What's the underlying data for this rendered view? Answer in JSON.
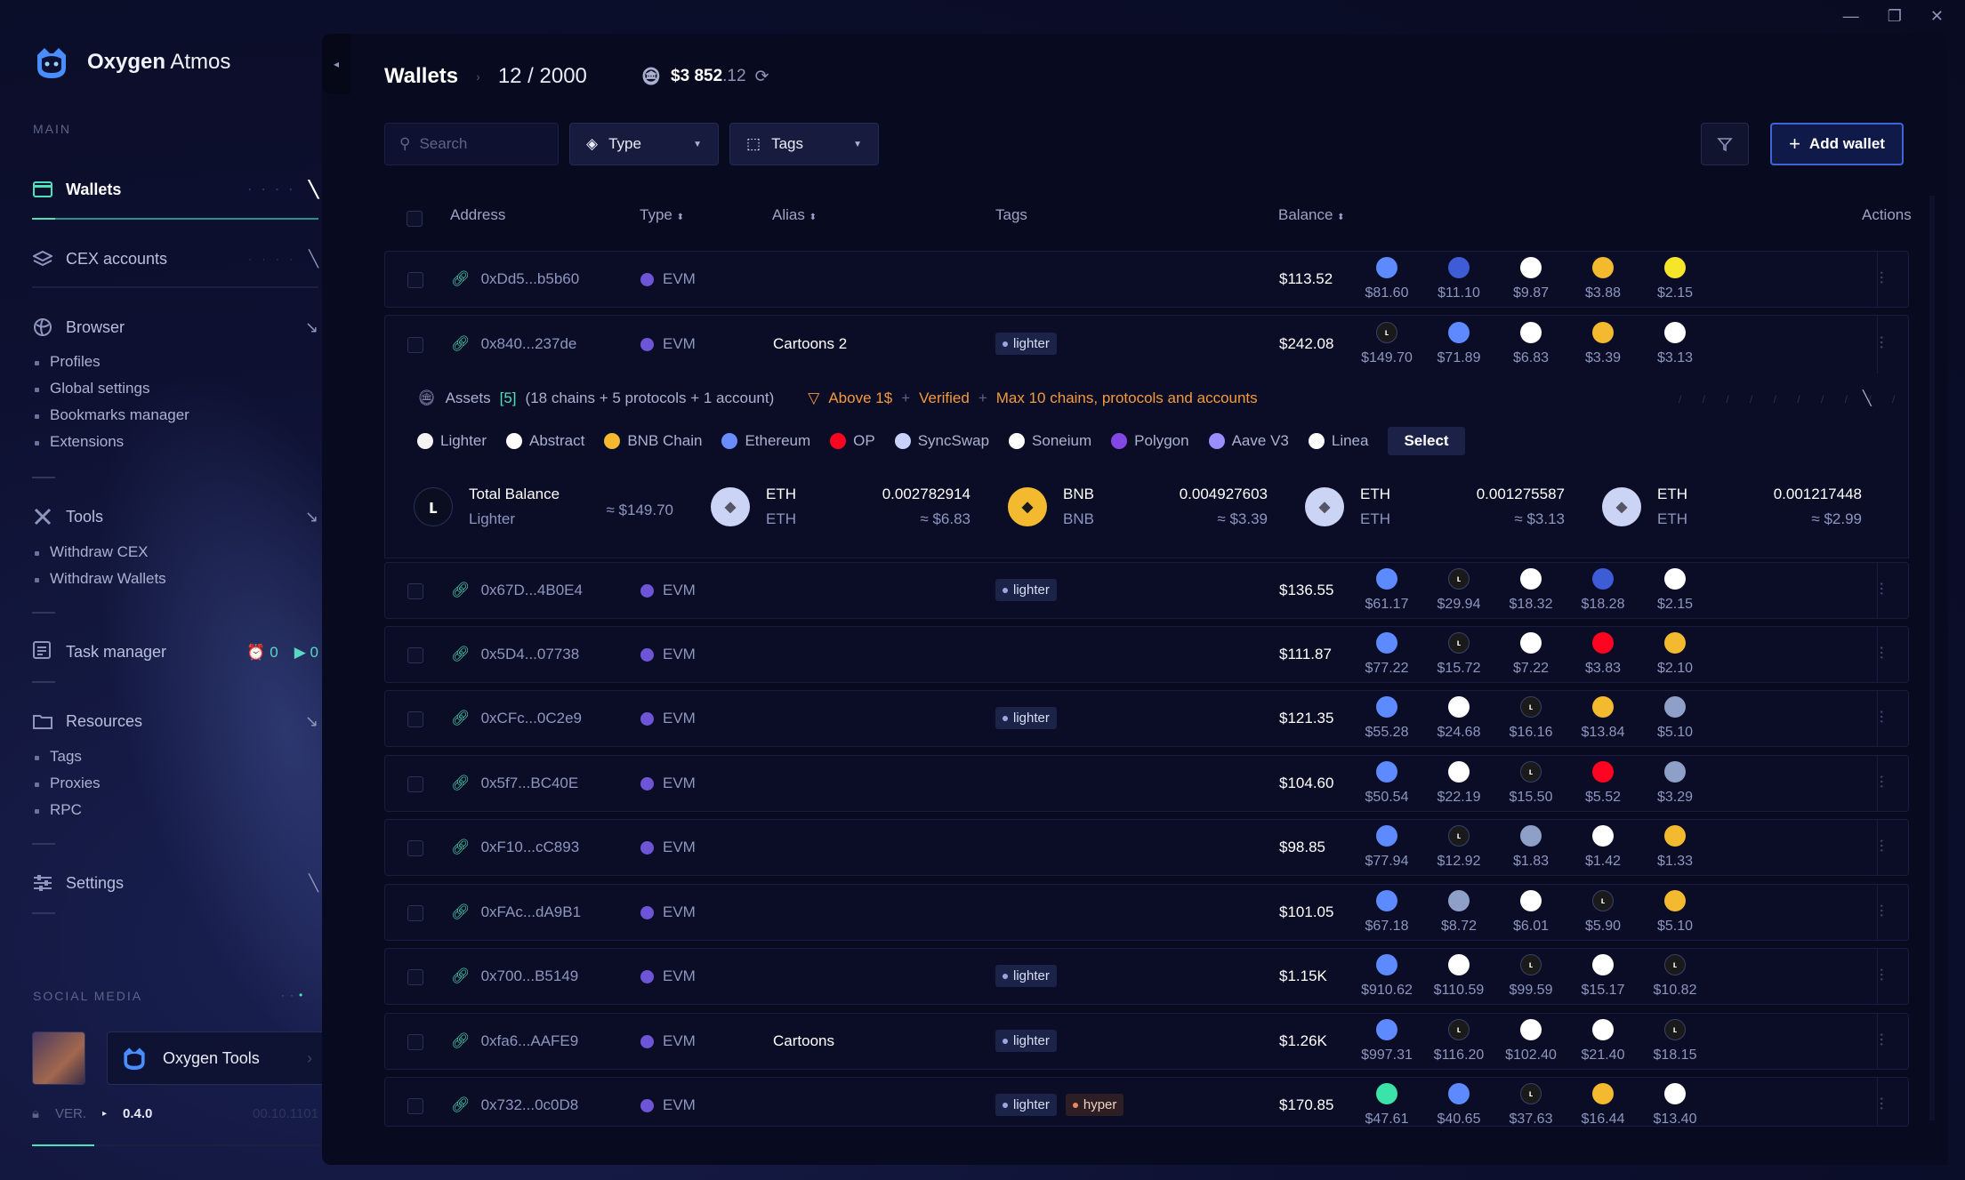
{
  "app": {
    "name_bold": "Oxygen",
    "name_light": "Atmos"
  },
  "colors": {
    "accent": "#4fe0b8",
    "primary_button": "#3e64d6",
    "warning": "#f39a3e",
    "bg": "#080a1f"
  },
  "sidebar": {
    "main_label": "MAIN",
    "wallets": "Wallets",
    "cex": "CEX accounts",
    "browser": "Browser",
    "browser_sub": [
      "Profiles",
      "Global settings",
      "Bookmarks manager",
      "Extensions"
    ],
    "tools": "Tools",
    "tools_sub": [
      "Withdraw CEX",
      "Withdraw Wallets"
    ],
    "task_manager": "Task manager",
    "task_counts": {
      "scheduled": "0",
      "running": "0"
    },
    "resources": "Resources",
    "resources_sub": [
      "Tags",
      "Proxies",
      "RPC"
    ],
    "settings": "Settings",
    "social_label": "SOCIAL MEDIA",
    "social_tool": "Oxygen Tools",
    "ver_label": "VER.",
    "version": "0.4.0",
    "ver_dim": "00.10.1101"
  },
  "header": {
    "title": "Wallets",
    "count": "12 / 2000",
    "balance_main": "$3 852",
    "balance_cents": ".12"
  },
  "toolbar": {
    "search_placeholder": "Search",
    "type_label": "Type",
    "tags_label": "Tags",
    "add_label": "Add wallet"
  },
  "table": {
    "headers": {
      "address": "Address",
      "type": "Type",
      "alias": "Alias",
      "tags": "Tags",
      "balance": "Balance",
      "actions": "Actions"
    }
  },
  "expanded": {
    "assets_label": "Assets",
    "assets_count": "[5]",
    "assets_desc": "(18 chains + 5 protocols + 1 account)",
    "filter_a": "Above 1$",
    "filter_b": "Verified",
    "filter_c": "Max 10 chains, protocols and accounts",
    "plus": "+",
    "chains": [
      {
        "n": "Lighter",
        "c": "#f4f4f4"
      },
      {
        "n": "Abstract",
        "c": "#ffffff"
      },
      {
        "n": "BNB Chain",
        "c": "#f3ba2f"
      },
      {
        "n": "Ethereum",
        "c": "#6a8cff"
      },
      {
        "n": "OP",
        "c": "#ff0420"
      },
      {
        "n": "SyncSwap",
        "c": "#c9d1ff"
      },
      {
        "n": "Soneium",
        "c": "#ffffff"
      },
      {
        "n": "Polygon",
        "c": "#8247e5"
      },
      {
        "n": "Aave V3",
        "c": "#9b8cff"
      },
      {
        "n": "Linea",
        "c": "#ffffff"
      }
    ],
    "select": "Select",
    "tiles": [
      {
        "name": "Total Balance",
        "sub": "Lighter",
        "amount": "",
        "usd": "≈ $149.70",
        "icon": "lighter",
        "c": "#0b0d20"
      },
      {
        "name": "ETH",
        "sub": "ETH",
        "amount": "0.002782914",
        "usd": "≈ $6.83",
        "icon": "eth",
        "c": "#ccd4f5"
      },
      {
        "name": "BNB",
        "sub": "BNB",
        "amount": "0.004927603",
        "usd": "≈ $3.39",
        "icon": "bnb",
        "c": "#f3ba2f"
      },
      {
        "name": "ETH",
        "sub": "ETH",
        "amount": "0.001275587",
        "usd": "≈ $3.13",
        "icon": "eth",
        "c": "#ccd4f5"
      },
      {
        "name": "ETH",
        "sub": "ETH",
        "amount": "0.001217448",
        "usd": "≈ $2.99",
        "icon": "eth",
        "c": "#ccd4f5"
      }
    ]
  },
  "rows": [
    {
      "address": "0xDd5...b5b60",
      "type": "EVM",
      "alias": "",
      "tags": [],
      "balance": "$113.52",
      "assets": [
        {
          "c": "#5d8bff",
          "v": "$81.60"
        },
        {
          "c": "#3e5cd6",
          "v": "$11.10"
        },
        {
          "c": "#ffffff",
          "v": "$9.87"
        },
        {
          "c": "#f3ba2f",
          "v": "$3.88"
        },
        {
          "c": "#f7e52a",
          "v": "$2.15"
        }
      ]
    },
    {
      "address": "0x840...237de",
      "type": "EVM",
      "alias": "Cartoons 2",
      "tags": [
        "lighter"
      ],
      "balance": "$242.08",
      "assets": [
        {
          "c": "#1a1a1a",
          "v": "$149.70"
        },
        {
          "c": "#5d8bff",
          "v": "$71.89"
        },
        {
          "c": "#ffffff",
          "v": "$6.83"
        },
        {
          "c": "#f3ba2f",
          "v": "$3.39"
        },
        {
          "c": "#ffffff",
          "v": "$3.13"
        }
      ]
    },
    {
      "address": "0x67D...4B0E4",
      "type": "EVM",
      "alias": "",
      "tags": [
        "lighter"
      ],
      "balance": "$136.55",
      "assets": [
        {
          "c": "#5d8bff",
          "v": "$61.17"
        },
        {
          "c": "#1a1a1a",
          "v": "$29.94"
        },
        {
          "c": "#ffffff",
          "v": "$18.32"
        },
        {
          "c": "#3e5cd6",
          "v": "$18.28"
        },
        {
          "c": "#ffffff",
          "v": "$2.15"
        }
      ]
    },
    {
      "address": "0x5D4...07738",
      "type": "EVM",
      "alias": "",
      "tags": [],
      "balance": "$111.87",
      "assets": [
        {
          "c": "#5d8bff",
          "v": "$77.22"
        },
        {
          "c": "#1a1a1a",
          "v": "$15.72"
        },
        {
          "c": "#ffffff",
          "v": "$7.22"
        },
        {
          "c": "#ff0420",
          "v": "$3.83"
        },
        {
          "c": "#f3ba2f",
          "v": "$2.10"
        }
      ]
    },
    {
      "address": "0xCFc...0C2e9",
      "type": "EVM",
      "alias": "",
      "tags": [
        "lighter"
      ],
      "balance": "$121.35",
      "assets": [
        {
          "c": "#5d8bff",
          "v": "$55.28"
        },
        {
          "c": "#ffffff",
          "v": "$24.68"
        },
        {
          "c": "#1a1a1a",
          "v": "$16.16"
        },
        {
          "c": "#f3ba2f",
          "v": "$13.84"
        },
        {
          "c": "#8ea0c8",
          "v": "$5.10"
        }
      ]
    },
    {
      "address": "0x5f7...BC40E",
      "type": "EVM",
      "alias": "",
      "tags": [],
      "balance": "$104.60",
      "assets": [
        {
          "c": "#5d8bff",
          "v": "$50.54"
        },
        {
          "c": "#ffffff",
          "v": "$22.19"
        },
        {
          "c": "#1a1a1a",
          "v": "$15.50"
        },
        {
          "c": "#ff0420",
          "v": "$5.52"
        },
        {
          "c": "#8ea0c8",
          "v": "$3.29"
        }
      ]
    },
    {
      "address": "0xF10...cC893",
      "type": "EVM",
      "alias": "",
      "tags": [],
      "balance": "$98.85",
      "assets": [
        {
          "c": "#5d8bff",
          "v": "$77.94"
        },
        {
          "c": "#1a1a1a",
          "v": "$12.92"
        },
        {
          "c": "#8ea0c8",
          "v": "$1.83"
        },
        {
          "c": "#ffffff",
          "v": "$1.42"
        },
        {
          "c": "#f3ba2f",
          "v": "$1.33"
        }
      ]
    },
    {
      "address": "0xFAc...dA9B1",
      "type": "EVM",
      "alias": "",
      "tags": [],
      "balance": "$101.05",
      "assets": [
        {
          "c": "#5d8bff",
          "v": "$67.18"
        },
        {
          "c": "#8ea0c8",
          "v": "$8.72"
        },
        {
          "c": "#ffffff",
          "v": "$6.01"
        },
        {
          "c": "#1a1a1a",
          "v": "$5.90"
        },
        {
          "c": "#f3ba2f",
          "v": "$5.10"
        }
      ]
    },
    {
      "address": "0x700...B5149",
      "type": "EVM",
      "alias": "",
      "tags": [
        "lighter"
      ],
      "balance": "$1.15K",
      "assets": [
        {
          "c": "#5d8bff",
          "v": "$910.62"
        },
        {
          "c": "#ffffff",
          "v": "$110.59"
        },
        {
          "c": "#1a1a1a",
          "v": "$99.59"
        },
        {
          "c": "#ffffff",
          "v": "$15.17"
        },
        {
          "c": "#1a1a1a",
          "v": "$10.82"
        }
      ]
    },
    {
      "address": "0xfa6...AAFE9",
      "type": "EVM",
      "alias": "Cartoons",
      "tags": [
        "lighter"
      ],
      "balance": "$1.26K",
      "assets": [
        {
          "c": "#5d8bff",
          "v": "$997.31"
        },
        {
          "c": "#1a1a1a",
          "v": "$116.20"
        },
        {
          "c": "#ffffff",
          "v": "$102.40"
        },
        {
          "c": "#ffffff",
          "v": "$21.40"
        },
        {
          "c": "#1a1a1a",
          "v": "$18.15"
        }
      ]
    },
    {
      "address": "0x732...0c0D8",
      "type": "EVM",
      "alias": "",
      "tags": [
        "lighter",
        "hyper"
      ],
      "balance": "$170.85",
      "assets": [
        {
          "c": "#3be3a8",
          "v": "$47.61"
        },
        {
          "c": "#5d8bff",
          "v": "$40.65"
        },
        {
          "c": "#1a1a1a",
          "v": "$37.63"
        },
        {
          "c": "#f3ba2f",
          "v": "$16.44"
        },
        {
          "c": "#ffffff",
          "v": "$13.40"
        }
      ]
    }
  ]
}
